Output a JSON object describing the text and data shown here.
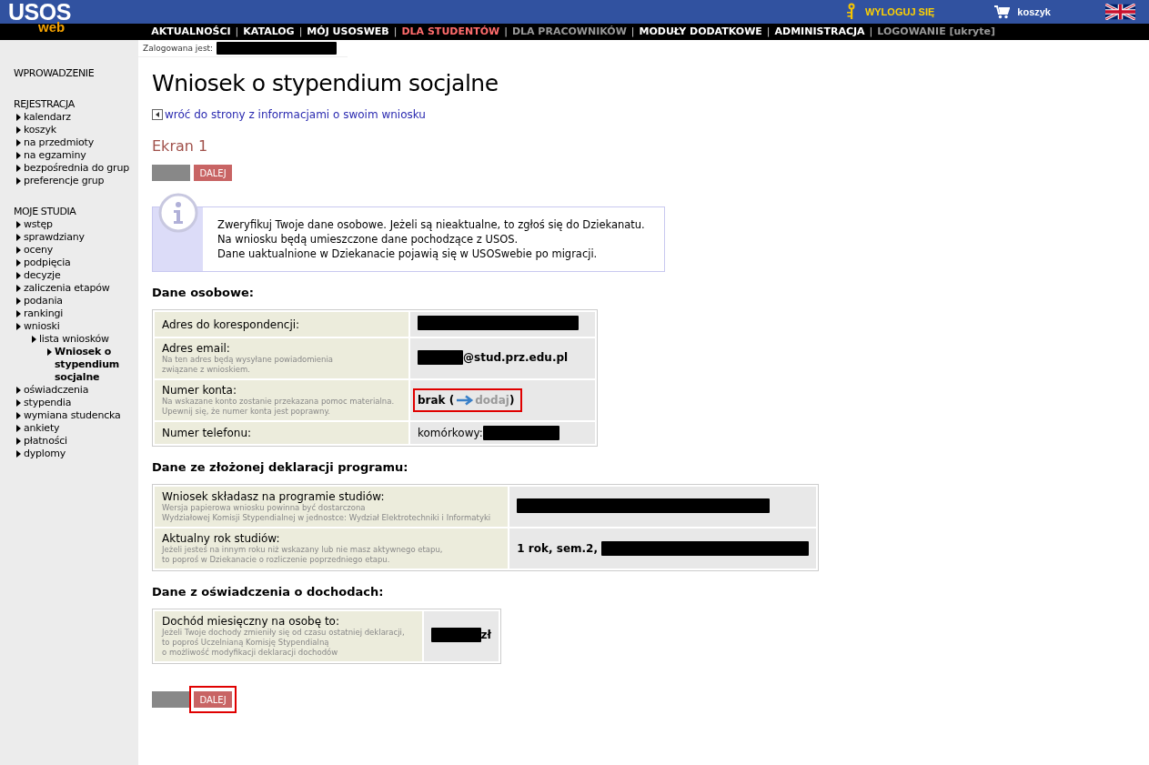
{
  "header": {
    "logo": "USOS",
    "logo_sub": "web",
    "logout": "WYLOGUJ SIĘ",
    "cart": "koszyk"
  },
  "nav": {
    "separator": "|",
    "items": [
      {
        "label": "AKTUALNOŚCI",
        "selected": false,
        "disabled": false
      },
      {
        "label": "KATALOG",
        "selected": false,
        "disabled": false
      },
      {
        "label": "MÓJ USOSWEB",
        "selected": false,
        "disabled": false
      },
      {
        "label": "DLA STUDENTÓW",
        "selected": true,
        "disabled": false
      },
      {
        "label": "DLA PRACOWNIKÓW",
        "selected": false,
        "disabled": true
      },
      {
        "label": "MODUŁY DODATKOWE",
        "selected": false,
        "disabled": false
      },
      {
        "label": "ADMINISTRACJA",
        "selected": false,
        "disabled": false
      },
      {
        "label": "LOGOWANIE [ukryte]",
        "selected": false,
        "disabled": true
      }
    ]
  },
  "login": {
    "label": "Zalogowana jest:"
  },
  "sidebar": [
    {
      "title": "WPROWADZENIE"
    },
    {
      "title": "REJESTRACJA",
      "items": [
        {
          "label": "kalendarz",
          "selected": false
        },
        {
          "label": "koszyk",
          "selected": false
        },
        {
          "label": "na przedmioty",
          "selected": false
        },
        {
          "label": "na egzaminy",
          "selected": false
        },
        {
          "label": "bezpośrednia do grup",
          "selected": false
        },
        {
          "label": "preferencje grup",
          "selected": false
        }
      ]
    },
    {
      "title": "MOJE STUDIA",
      "items": [
        {
          "label": "wstęp",
          "selected": false
        },
        {
          "label": "sprawdziany",
          "selected": false
        },
        {
          "label": "oceny",
          "selected": false
        },
        {
          "label": "podpięcia",
          "selected": false
        },
        {
          "label": "decyzje",
          "selected": false
        },
        {
          "label": "zaliczenia etapów",
          "selected": false
        },
        {
          "label": "podania",
          "selected": false
        },
        {
          "label": "rankingi",
          "selected": false
        },
        {
          "label": "wnioski",
          "selected": false,
          "children": [
            {
              "label": "lista wniosków",
              "selected": false,
              "children": [
                {
                  "label": "Wniosek o stypendium socjalne",
                  "selected": true
                }
              ]
            }
          ]
        },
        {
          "label": "oświadczenia",
          "selected": false
        },
        {
          "label": "stypendia",
          "selected": false
        },
        {
          "label": "wymiana studencka",
          "selected": false
        },
        {
          "label": "ankiety",
          "selected": false
        },
        {
          "label": "płatności",
          "selected": false
        },
        {
          "label": "dyplomy",
          "selected": false
        }
      ]
    }
  ],
  "page": {
    "title": "Wniosek o stypendium socjalne",
    "back_link": "wróć do strony z informacjami o swoim wniosku",
    "screen_title": "Ekran 1",
    "buttons_top": [
      {
        "kind": "previous",
        "highlighted": false
      },
      {
        "kind": "next",
        "label": "DALEJ",
        "highlighted": false
      }
    ],
    "info": [
      "Zweryfikuj Twoje dane osobowe. Jeżeli są nieaktualne, to zgłoś się do Dziekanatu.",
      "Na wniosku będą umieszczone dane pochodzące z USOS.",
      "Dane uaktualnione w Dziekanacie pojawią się w USOSwebie po migracji."
    ],
    "sections": [
      {
        "title": "Dane osobowe:",
        "rows": [
          {
            "label": "Adres do korespondencji:",
            "highlighted": false,
            "value": [
              {
                "kind": "redacted"
              }
            ]
          },
          {
            "label": "Adres email:",
            "hint": [
              "Na ten adres będą wysyłane powiadomienia",
              "związane z wnioskiem."
            ],
            "highlighted": false,
            "value": [
              {
                "kind": "redacted"
              },
              {
                "kind": "bold",
                "text": "@stud.prz.edu.pl"
              }
            ]
          },
          {
            "label": "Numer konta:",
            "hint": [
              "Na wskazane konto zostanie przekazana pomoc materialna.",
              "Upewnij się, że numer konta jest poprawny."
            ],
            "highlighted": true,
            "value": [
              {
                "kind": "bold",
                "text": "brak ("
              },
              {
                "kind": "arrow"
              },
              {
                "kind": "link",
                "text": "dodaj"
              },
              {
                "kind": "bold",
                "text": ")"
              }
            ]
          },
          {
            "label": "Numer telefonu:",
            "highlighted": false,
            "value": [
              {
                "kind": "text",
                "text": "komórkowy:"
              },
              {
                "kind": "redacted"
              }
            ]
          }
        ]
      },
      {
        "title": "Dane ze złożonej deklaracji programu:",
        "rows": [
          {
            "label": "Wniosek składasz na programie studiów:",
            "hint": [
              "Wersja papierowa wniosku powinna być dostarczona",
              "Wydziałowej Komisji Stypendialnej w jednostce: Wydział Elektrotechniki i Informatyki"
            ],
            "highlighted": false,
            "value": [
              {
                "kind": "redacted"
              }
            ]
          },
          {
            "label": "Aktualny rok studiów:",
            "hint": [
              "Jeżeli jesteś na innym roku niż wskazany lub nie masz aktywnego etapu,",
              "to poproś w Dziekanacie o rozliczenie poprzedniego etapu."
            ],
            "highlighted": false,
            "value": [
              {
                "kind": "bold",
                "text": "1 rok, sem.2,"
              },
              {
                "kind": "redacted"
              }
            ]
          }
        ]
      },
      {
        "title": "Dane z oświadczenia o dochodach:",
        "rows": [
          {
            "label": "Dochód miesięczny na osobę to:",
            "hint": [
              "Jeżeli Twoje dochody zmieniły się od czasu ostatniej deklaracji,",
              "to poproś Uczelnianą Komisję Stypendialną",
              "o możliwość modyfikacji deklaracji dochodów"
            ],
            "highlighted": false,
            "value": [
              {
                "kind": "redacted"
              },
              {
                "kind": "bold",
                "text": "zł"
              }
            ]
          }
        ]
      }
    ],
    "buttons_bottom": [
      {
        "kind": "previous",
        "highlighted": false
      },
      {
        "kind": "next",
        "label": "DALEJ",
        "highlighted": true
      }
    ]
  }
}
